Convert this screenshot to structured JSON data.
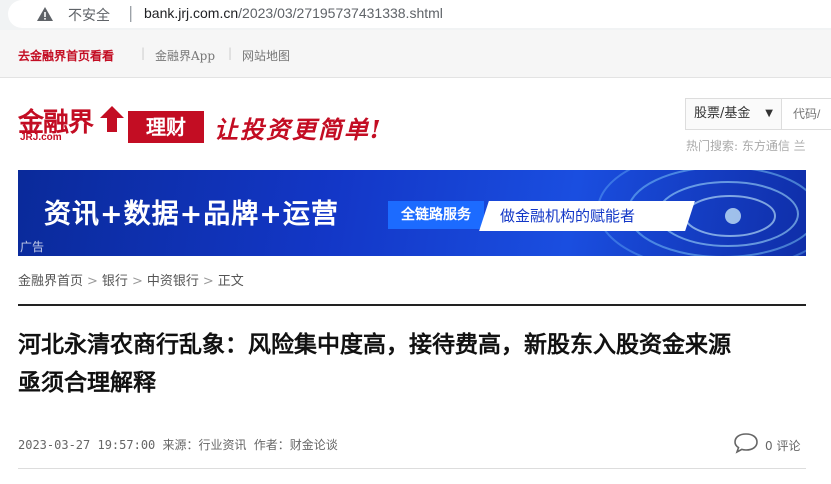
{
  "browser": {
    "security_label": "不安全",
    "url_host": "bank.jrj.com.cn",
    "url_path": "/2023/03/27195737431338.shtml"
  },
  "topnav": {
    "items": [
      "去金融界首页看看",
      "金融界App",
      "网站地图"
    ]
  },
  "header": {
    "logo_cn": "金融界",
    "logo_en": "JRJ.com",
    "channel": "理财",
    "slogan": "让投资更简单!",
    "search_select": "股票/基金",
    "search_placeholder": "代码/",
    "hot_search": "热门搜索:  东方通信   兰"
  },
  "banner": {
    "main_text": "资讯+数据+品牌+运营",
    "badge": "全链路服务",
    "pill": "做金融机构的赋能者",
    "ad_label": "广告"
  },
  "breadcrumb": [
    "金融界首页",
    "银行",
    "中资银行",
    "正文"
  ],
  "article": {
    "title_line1": "河北永清农商行乱象：风险集中度高，接待费高，新股东入股资金来源",
    "title_line2": "亟须合理解释",
    "datetime": "2023-03-27 19:57:00",
    "source_label": "来源：",
    "source": "行业资讯",
    "author_label": "作者：",
    "author": "财金论谈",
    "comment_count": "0",
    "comment_label": "评论"
  },
  "colors": {
    "brand_red": "#c30d23",
    "banner_blue": "#1337c7"
  }
}
